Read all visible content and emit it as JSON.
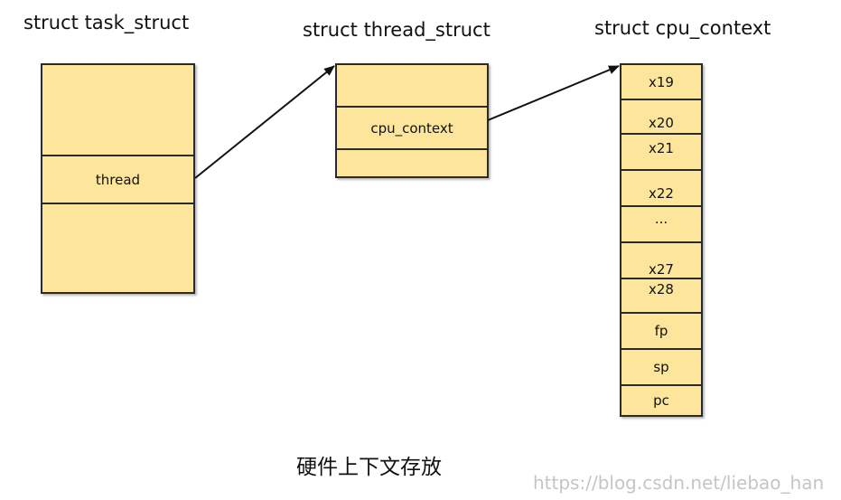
{
  "task_struct": {
    "title": "struct task_struct",
    "field": "thread"
  },
  "thread_struct": {
    "title": "struct thread_struct",
    "field": "cpu_context"
  },
  "cpu_context": {
    "title": "struct cpu_context",
    "registers": [
      "x19",
      "x20",
      "x21",
      "x22",
      "...",
      "x27",
      "x28",
      "fp",
      "sp",
      "pc"
    ]
  },
  "caption": "硬件上下文存放",
  "watermark": "https://blog.csdn.net/liebao_han",
  "colors": {
    "box_fill": "#fde69b",
    "border": "#2a2a2a",
    "arrow": "#111111"
  }
}
